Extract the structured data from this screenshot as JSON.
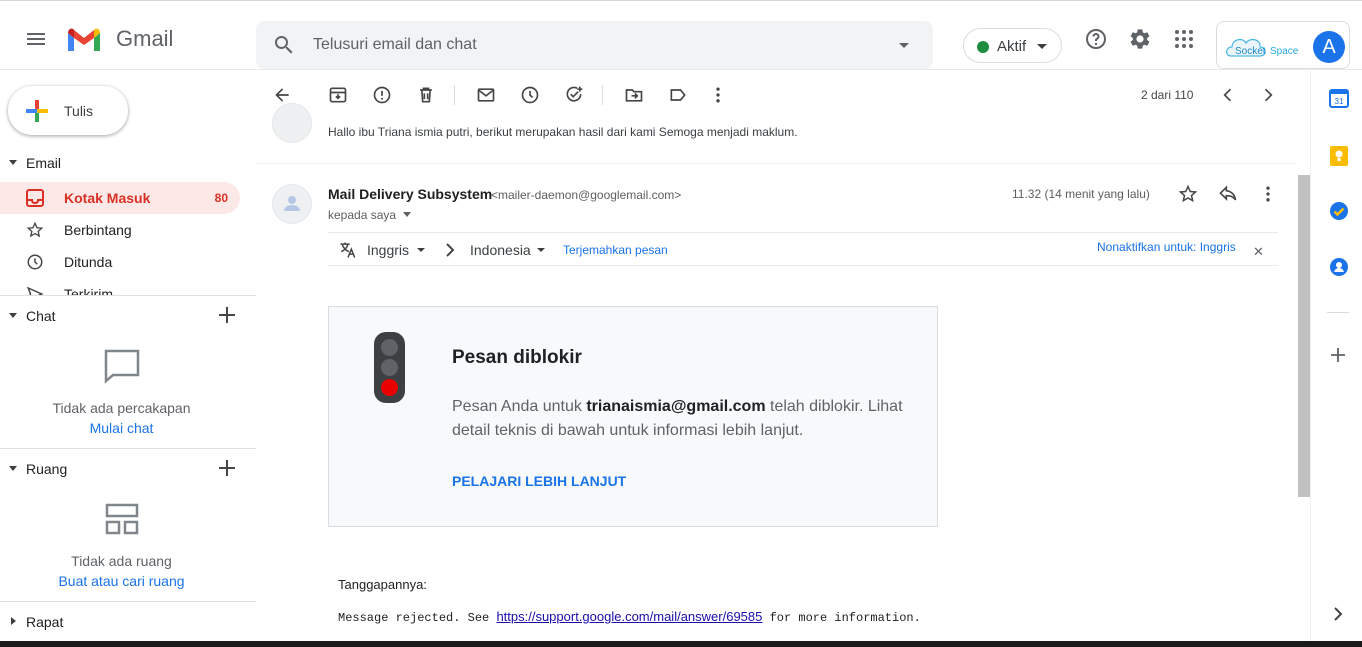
{
  "app": {
    "title": "Gmail"
  },
  "search": {
    "placeholder": "Telusuri email dan chat"
  },
  "status": {
    "label": "Aktif"
  },
  "account": {
    "initial": "A",
    "brand": "Socket Space"
  },
  "compose": {
    "label": "Tulis"
  },
  "email_section": {
    "label": "Email",
    "items": [
      {
        "label": "Kotak Masuk",
        "count": "80",
        "icon": "inbox-icon"
      },
      {
        "label": "Berbintang",
        "icon": "star-icon"
      },
      {
        "label": "Ditunda",
        "icon": "clock-icon"
      },
      {
        "label": "Terkirim",
        "icon": "send-icon"
      }
    ]
  },
  "chat_section": {
    "label": "Chat",
    "empty_text": "Tidak ada percakapan",
    "link": "Mulai chat"
  },
  "rooms_section": {
    "label": "Ruang",
    "empty_text": "Tidak ada ruang",
    "link": "Buat atau cari ruang"
  },
  "meet_section": {
    "label": "Rapat"
  },
  "toolbar": {
    "page_count": "2 dari 110"
  },
  "prev_message": {
    "snippet": "Hallo ibu Triana ismia putri, berikut merupakan hasil dari kami Semoga menjadi maklum."
  },
  "message": {
    "sender": "Mail Delivery Subsystem",
    "address": "<mailer-daemon@googlemail.com>",
    "to": "kepada saya",
    "time": "11.32 (14 menit yang lalu)"
  },
  "translate": {
    "from": "Inggris",
    "to": "Indonesia",
    "action": "Terjemahkan pesan",
    "disable": "Nonaktifkan untuk: Inggris"
  },
  "blocked": {
    "title": "Pesan diblokir",
    "body_before": "Pesan Anda untuk ",
    "email": "trianaismia@gmail.com",
    "body_after": " telah diblokir. Lihat detail teknis di bawah untuk informasi lebih lanjut.",
    "learn_more": "PELAJARI LEBIH LANJUT"
  },
  "response": {
    "label": "Tanggapannya:",
    "before": "Message rejected. See ",
    "link": "https://support.google.com/mail/answer/69585",
    "after": " for more information."
  },
  "colors": {
    "accent": "#1a73e8",
    "inbox_active": "#d93025",
    "blocked_red": "#ea0000"
  }
}
